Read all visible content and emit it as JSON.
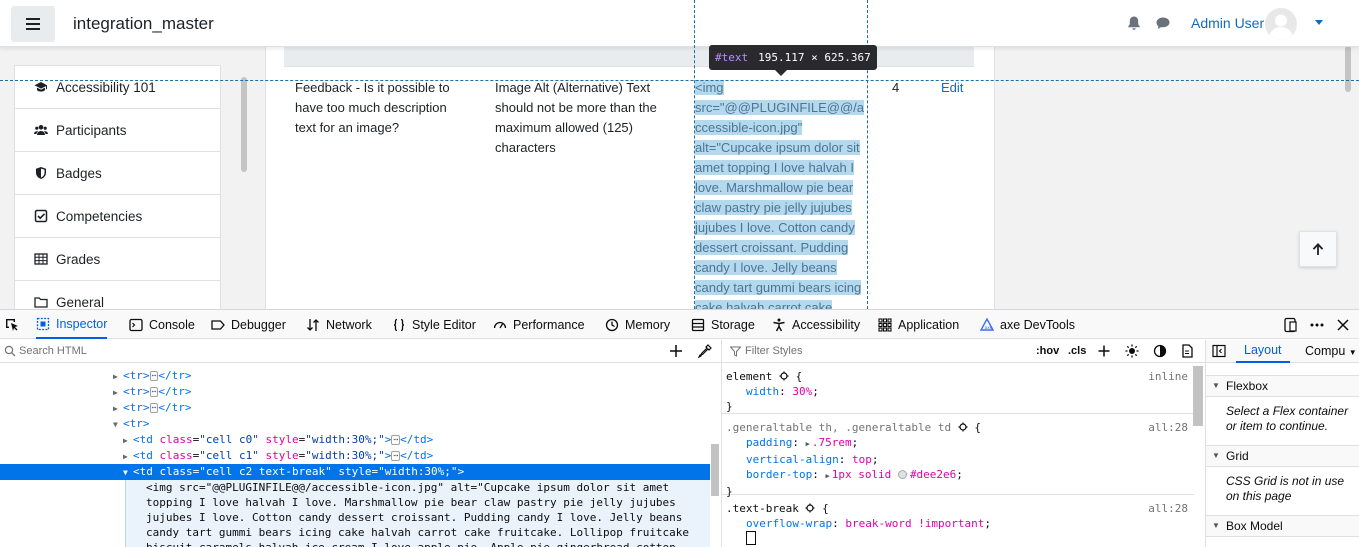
{
  "navbar": {
    "site_name": "integration_master",
    "user_name": "Admin User"
  },
  "drawer": {
    "items": [
      {
        "label": "Accessibility 101",
        "icon": "graduation-cap-icon"
      },
      {
        "label": "Participants",
        "icon": "users-icon"
      },
      {
        "label": "Badges",
        "icon": "shield-icon"
      },
      {
        "label": "Competencies",
        "icon": "check-square-icon"
      },
      {
        "label": "Grades",
        "icon": "table-icon"
      },
      {
        "label": "General",
        "icon": "folder-icon"
      }
    ]
  },
  "table": {
    "row": {
      "c0": "Feedback - Is it possible to have too much description text for an image?",
      "c1": "Image Alt (Alternative) Text should not be more than the maximum allowed (125) characters",
      "c2_lines": [
        "<img",
        "src=\"@@PLUGINFILE@@/a",
        "ccessible-icon.jpg\"",
        "alt=\"Cupcake ipsum dolor sit",
        "amet topping I love halvah I",
        "love. Marshmallow pie bear",
        "claw pastry pie jelly jujubes",
        "jujubes I love. Cotton candy",
        "dessert croissant. Pudding",
        "candy I love. Jelly beans",
        "candy tart gummi bears icing",
        "cake halvah carrot cake"
      ],
      "c3": "4",
      "c4": "Edit"
    }
  },
  "highlighter": {
    "node_type": "#text",
    "dimensions": "195.117 × 625.367"
  },
  "devtools": {
    "tabs": [
      {
        "label": "Inspector",
        "icon": "inspector-icon",
        "selected": true
      },
      {
        "label": "Console",
        "icon": "console-icon"
      },
      {
        "label": "Debugger",
        "icon": "debugger-icon"
      },
      {
        "label": "Network",
        "icon": "network-icon"
      },
      {
        "label": "Style Editor",
        "icon": "style-editor-icon"
      },
      {
        "label": "Performance",
        "icon": "performance-icon"
      },
      {
        "label": "Memory",
        "icon": "memory-icon"
      },
      {
        "label": "Storage",
        "icon": "storage-icon"
      },
      {
        "label": "Accessibility",
        "icon": "accessibility-icon"
      },
      {
        "label": "Application",
        "icon": "application-icon"
      },
      {
        "label": "axe DevTools",
        "icon": "axe-icon"
      }
    ],
    "html_search_placeholder": "Search HTML",
    "tree": {
      "tr1": "<tr>",
      "tr_close": "</tr>",
      "tr_open": "<tr>",
      "td0_open": "<td",
      "td0_class_attr": "class",
      "td0_class_val": "\"cell c0\"",
      "td_style_attr": "style",
      "td_style_val": "\"width:30%;\"",
      "td_close": "</td>",
      "td1_class_val": "\"cell c1\"",
      "td2_class_val": "\"cell c2 text-break\"",
      "text_content": "<img src=\"@@PLUGINFILE@@/accessible-icon.jpg\" alt=\"Cupcake ipsum dolor sit amet\ntopping I love halvah I love. Marshmallow pie bear claw pastry pie jelly jujubes\njujubes I love. Cotton candy dessert croissant. Pudding candy I love. Jelly beans\ncandy tart gummi bears icing cake halvah carrot cake fruitcake. Lollipop fruitcake\nbiscuit caramels halvah ice cream I love apple pie. Apple pie gingerbread cotton"
    },
    "rules": {
      "filter_placeholder": "Filter Styles",
      "hov": ":hov",
      "cls": ".cls",
      "rule1": {
        "selector": "element",
        "source": "inline",
        "prop": "width",
        "value": "30%"
      },
      "rule2": {
        "selector": ".generaltable th, .generaltable td",
        "source": "all:28",
        "props": [
          {
            "name": "padding",
            "value": ".75rem"
          },
          {
            "name": "vertical-align",
            "value": "top"
          },
          {
            "name": "border-top",
            "value": "1px solid",
            "color": "#dee2e6"
          }
        ]
      },
      "rule3": {
        "selector": ".text-break",
        "source": "all:28",
        "prop": "overflow-wrap",
        "value": "break-word !important"
      }
    },
    "layout": {
      "tab_layout": "Layout",
      "tab_computed": "Compu",
      "flexbox_title": "Flexbox",
      "flexbox_msg": "Select a Flex container or item to continue.",
      "grid_title": "Grid",
      "grid_msg": "CSS Grid is not in use on this page",
      "boxmodel_title": "Box Model"
    }
  },
  "colors": {
    "accent": "#0f6cbf",
    "devtools_blue": "#0074e8",
    "highlight": "#b5d9ec"
  }
}
